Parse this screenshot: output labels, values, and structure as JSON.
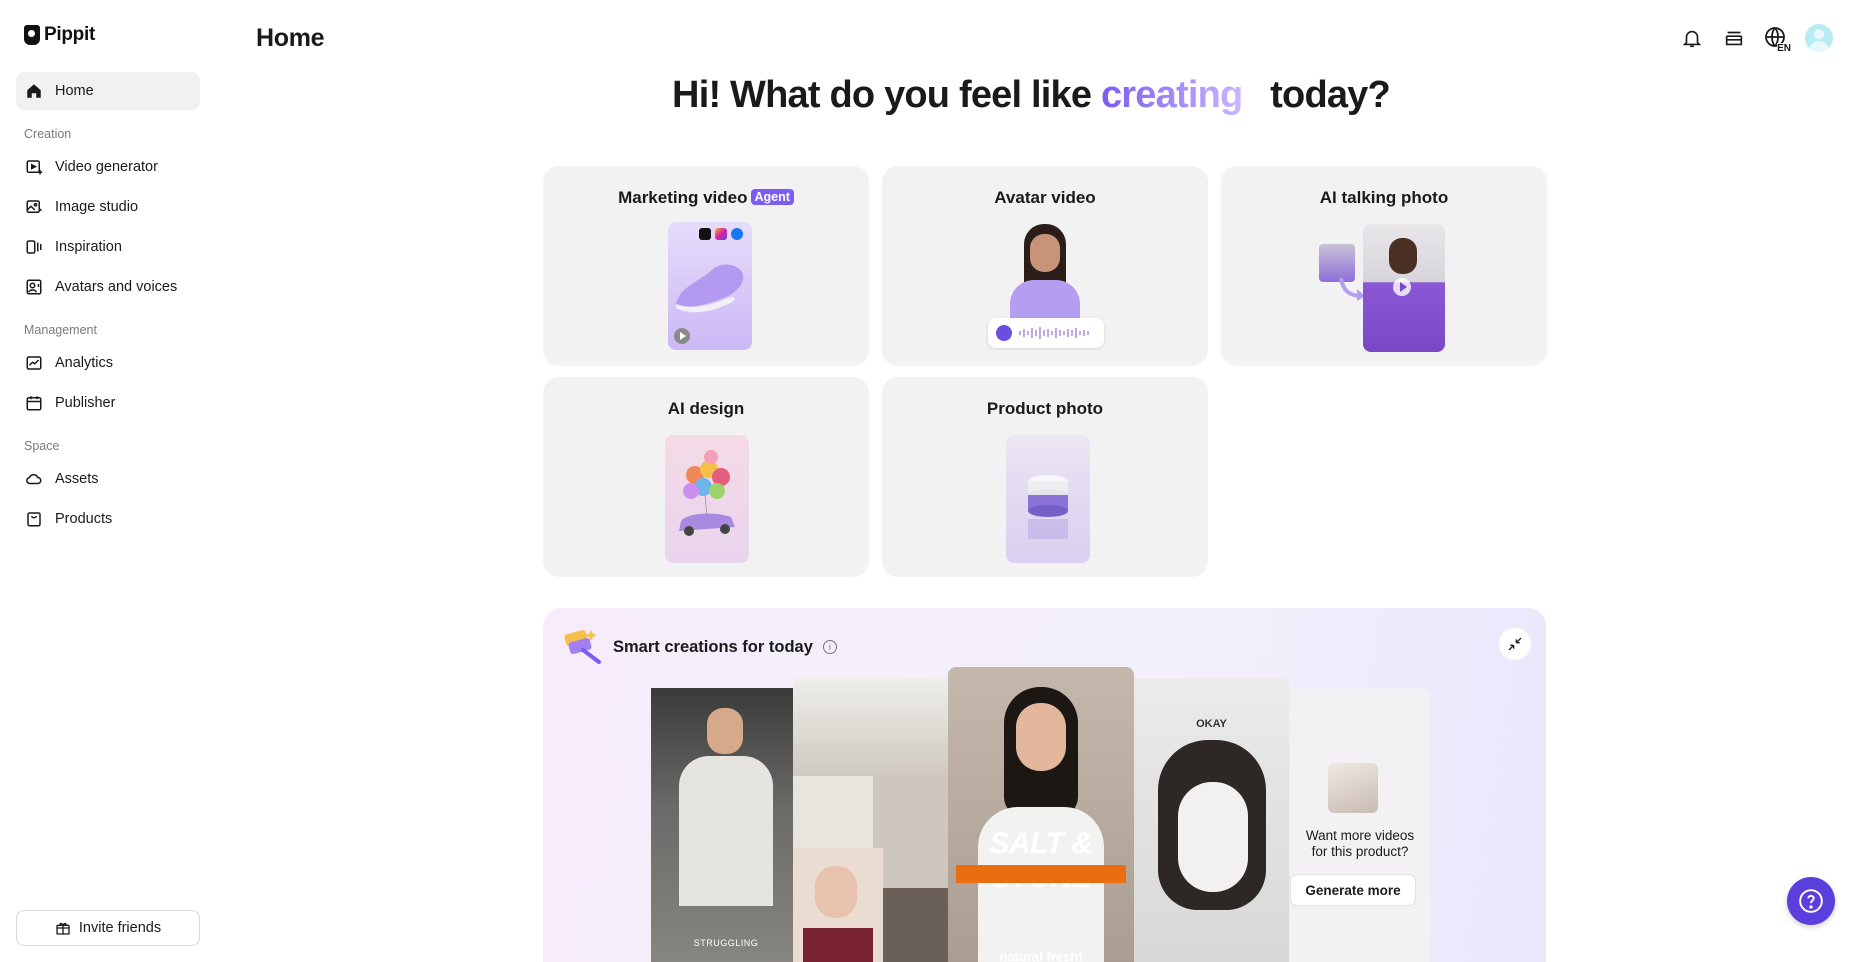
{
  "app": {
    "name": "Pippit"
  },
  "header": {
    "title": "Home",
    "lang": "EN"
  },
  "sidebar": {
    "home": "Home",
    "sections": {
      "creation": "Creation",
      "management": "Management",
      "space": "Space"
    },
    "creation_items": [
      "Video generator",
      "Image studio",
      "Inspiration",
      "Avatars and voices"
    ],
    "management_items": [
      "Analytics",
      "Publisher"
    ],
    "space_items": [
      "Assets",
      "Products"
    ],
    "invite": "Invite friends"
  },
  "greeting": {
    "before": "Hi! What do you feel like",
    "highlight": "creating",
    "after": "today?"
  },
  "cards": [
    {
      "title": "Marketing video",
      "badge": "Agent"
    },
    {
      "title": "Avatar video"
    },
    {
      "title": "AI talking photo"
    },
    {
      "title": "AI design"
    },
    {
      "title": "Product photo"
    }
  ],
  "smart": {
    "title": "Smart creations for today",
    "videos": [
      {
        "caption": "STRUGGLING"
      },
      {
        "caption": ""
      },
      {
        "caption": "SALT & STONE",
        "subcaption": "natural fresh!"
      },
      {
        "caption": "OKAY"
      }
    ],
    "more_text_1": "Want more videos",
    "more_text_2": "for this product?",
    "generate_more": "Generate more"
  },
  "colors": {
    "accent": "#7b5cf5",
    "help_button": "#5b3fdc",
    "card_bg": "#f2f2f2"
  }
}
